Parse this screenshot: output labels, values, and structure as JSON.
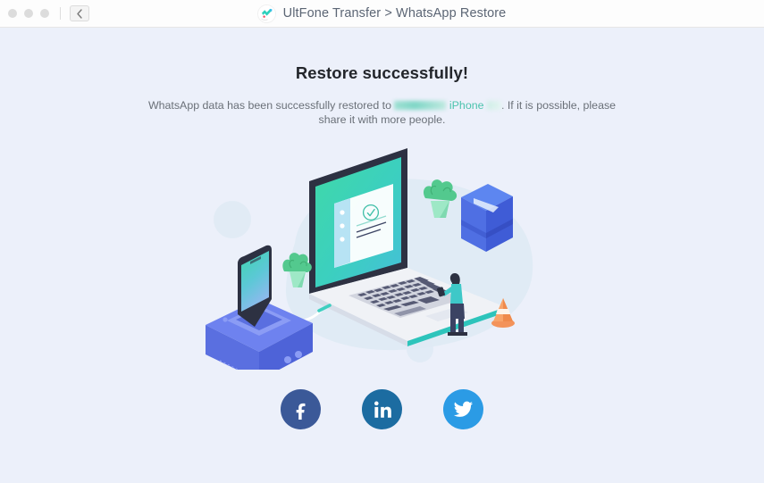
{
  "window": {
    "traffic_lights": [
      "close",
      "minimize",
      "zoom"
    ],
    "back_button_icon": "chevron-left-icon",
    "logo_icon": "ultfone-logo-icon",
    "title": "UltFone Transfer > WhatsApp Restore"
  },
  "main": {
    "headline": "Restore successfully!",
    "description_before": "WhatsApp data has been successfully restored to",
    "device_name_redacted": "",
    "device_model": "iPhone",
    "description_after": ". If it is possible, please share it with more people.",
    "illustration": {
      "name": "isometric-laptop-phone-dock-illustration",
      "laptop_screen_icon": "check-circle-icon",
      "objects": [
        "laptop",
        "smartphone",
        "charging-dock",
        "plant",
        "plant",
        "file-box",
        "person",
        "traffic-cone"
      ]
    }
  },
  "social": {
    "buttons": [
      {
        "name": "facebook",
        "label": "Facebook",
        "color": "#3b5998"
      },
      {
        "name": "linkedin",
        "label": "LinkedIn",
        "color": "#1c6ca1"
      },
      {
        "name": "twitter",
        "label": "Twitter",
        "color": "#2b9be5"
      }
    ]
  },
  "colors": {
    "page_background": "#ecf0fa",
    "titlebar_background": "#fdfdfd",
    "accent_teal": "#4bc3ad",
    "heading_text": "#23262b",
    "body_text": "#6a7078"
  }
}
